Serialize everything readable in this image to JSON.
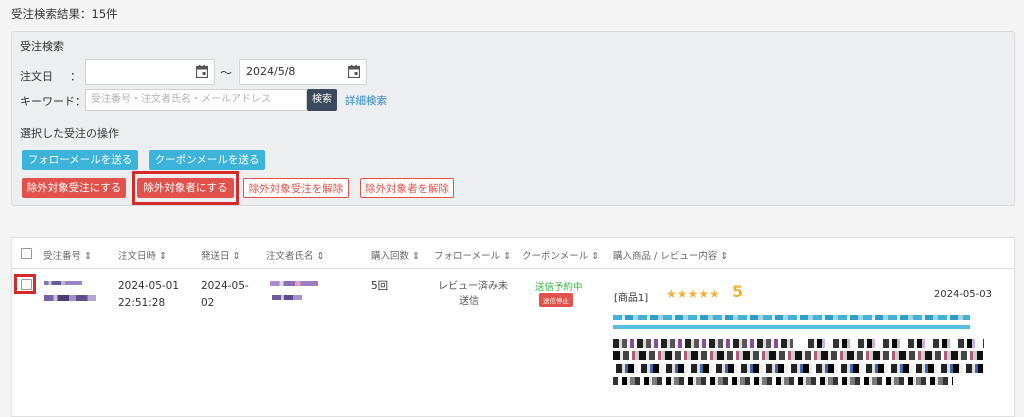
{
  "result_title": "受注検索結果：15件",
  "search": {
    "title": "受注検索",
    "date_label": "注文日",
    "date_colon": "：",
    "date_from": "",
    "date_tilde": "～",
    "date_to": "2024/5/8",
    "keyword_label": "キーワード：",
    "keyword_placeholder": "受注番号・注文者氏名・メールアドレス",
    "search_button": "検索",
    "advanced_link": "詳細検索"
  },
  "operations": {
    "title": "選択した受注の操作",
    "follow_mail": "フォローメールを送る",
    "coupon_mail": "クーポンメールを送る",
    "exclude_order": "除外対象受注にする",
    "exclude_person": "除外対象者にする",
    "unexclude_order": "除外対象受注を解除",
    "unexclude_person": "除外対象者を解除"
  },
  "table": {
    "headers": {
      "order_no": "受注番号",
      "order_datetime": "注文日時",
      "ship_date": "発送日",
      "customer": "注文者氏名",
      "purchase_count": "購入回数",
      "follow_mail": "フォローメール",
      "coupon_mail": "クーポンメール",
      "product_review": "購入商品 / レビュー内容"
    },
    "rows": [
      {
        "order_date": "2024-05-01",
        "order_time": "22:51:28",
        "ship_date_1": "2024-05-",
        "ship_date_2": "02",
        "purchase_count": "5回",
        "follow_status_1": "レビュー済み未",
        "follow_status_2": "送信",
        "coupon_status": "送信予約中",
        "coupon_badge": "送信停止",
        "product": "[商品1]",
        "stars": "★★★★★",
        "rating": "5",
        "review_date": "2024-05-03"
      }
    ]
  },
  "colors": {
    "blue_button": "#3cb3d8",
    "red_button": "#e0524b",
    "highlight": "#d42a2a",
    "link": "#2d89c8",
    "star": "#f1b23a",
    "status_green": "#35b53f"
  }
}
